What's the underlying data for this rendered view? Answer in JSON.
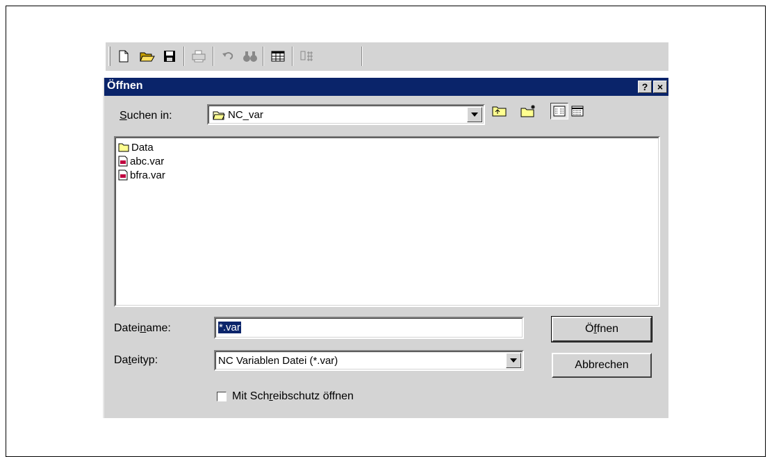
{
  "toolbar": {
    "icons": [
      "new-file-icon",
      "open-folder-icon",
      "save-icon",
      "print-icon",
      "undo-icon",
      "find-icon",
      "table-icon",
      "network-icon"
    ]
  },
  "dialog": {
    "title": "Öffnen",
    "help_btn": "?",
    "close_btn": "×",
    "look_in_label_pre": "S",
    "look_in_label_post": "uchen in:",
    "look_in_value": "NC_var",
    "files": [
      {
        "name": "Data",
        "type": "folder"
      },
      {
        "name": "abc.var",
        "type": "file"
      },
      {
        "name": "bfra.var",
        "type": "file"
      }
    ],
    "filename_label_pre": "Datei",
    "filename_label_u": "n",
    "filename_label_post": "ame:",
    "filename_value": "*.var",
    "filetype_label_pre": "Da",
    "filetype_label_u": "t",
    "filetype_label_post": "eityp:",
    "filetype_value": "NC Variablen Datei (*.var)",
    "open_button_pre": "Ö",
    "open_button_u": "f",
    "open_button_post": "fnen",
    "cancel_button": "Abbrechen",
    "readonly_pre": "Mit Sch",
    "readonly_u": "r",
    "readonly_post": "eibschutz öffnen"
  }
}
